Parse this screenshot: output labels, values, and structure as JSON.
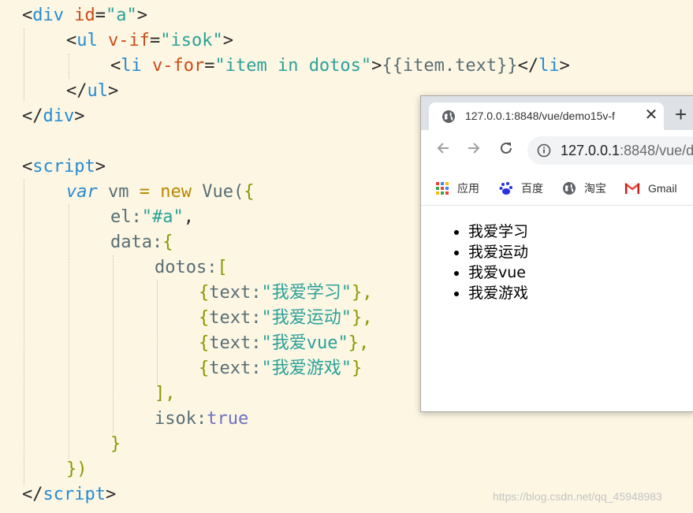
{
  "code": {
    "l1": {
      "lt": "<",
      "tag": "div",
      "attr": "id",
      "eq": "=",
      "val": "\"a\"",
      "gt": ">"
    },
    "l2": {
      "lt": "<",
      "tag": "ul",
      "attr": "v-if",
      "eq": "=",
      "val": "\"isok\"",
      "gt": ">"
    },
    "l3": {
      "lt": "<",
      "tag": "li",
      "attr": "v-for",
      "eq": "=",
      "val": "\"item in dotos\"",
      "gt": ">",
      "mustache": "{{item.text}}",
      "close_lt": "</",
      "close_tag": "li",
      "close_gt": ">"
    },
    "l4": {
      "lt": "</",
      "tag": "ul",
      "gt": ">"
    },
    "l5": {
      "lt": "</",
      "tag": "div",
      "gt": ">"
    },
    "l7": {
      "lt": "<",
      "tag": "script",
      "gt": ">"
    },
    "l8": {
      "var": "var",
      "ident": " vm ",
      "eq": "=",
      "new": " new",
      "call": " Vue(",
      "brace": "{"
    },
    "l9": {
      "prop": "el:",
      "val": "\"#a\"",
      "comma": ","
    },
    "l10": {
      "prop": "data:",
      "brace": "{"
    },
    "l11": {
      "prop": "dotos:",
      "bracket": "["
    },
    "l12": {
      "open": "{",
      "key": "text:",
      "val": "\"我爱学习\"",
      "close": "},"
    },
    "l13": {
      "open": "{",
      "key": "text:",
      "val": "\"我爱运动\"",
      "close": "},"
    },
    "l14": {
      "open": "{",
      "key": "text:",
      "val": "\"我爱vue\"",
      "close": "},"
    },
    "l15": {
      "open": "{",
      "key": "text:",
      "val": "\"我爱游戏\"",
      "close": "}"
    },
    "l16": {
      "bracket": "],"
    },
    "l17": {
      "prop": "isok:",
      "val": "true"
    },
    "l18": {
      "brace": "}"
    },
    "l19": {
      "close": "})"
    },
    "l20": {
      "lt": "</",
      "tag": "script",
      "gt": ">"
    }
  },
  "browser": {
    "tab_title": "127.0.0.1:8848/vue/demo15v-f",
    "tab_close": "✕",
    "new_tab": "+",
    "url_host": "127.0.0.1",
    "url_rest": ":8848/vue/d",
    "bookmarks": [
      "应用",
      "百度",
      "淘宝",
      "Gmail"
    ],
    "list_items": [
      "我爱学习",
      "我爱运动",
      "我爱vue",
      "我爱游戏"
    ]
  },
  "watermark": "https://blog.csdn.net/qq_45948983",
  "colors": {
    "editor_bg": "#fdf6e3",
    "tag": "#268bd2",
    "attr": "#cb4b16",
    "string": "#2aa198",
    "keyword": "#b58900",
    "bool": "#6c71c4"
  }
}
